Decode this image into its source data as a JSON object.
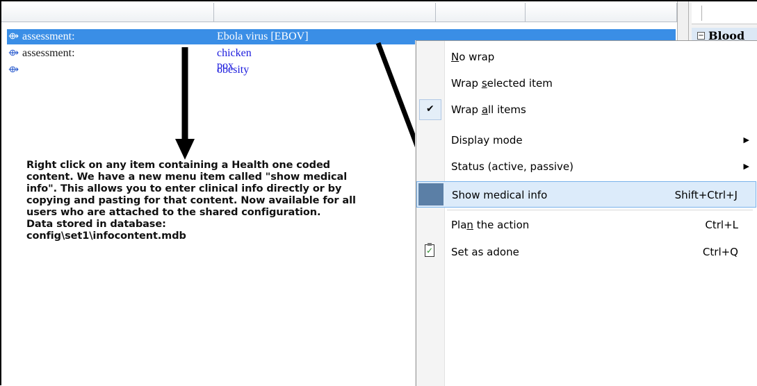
{
  "rows": [
    {
      "label": "assessment:",
      "value": "Ebola virus [EBOV]",
      "selected": true
    },
    {
      "label": "assessment:",
      "value": "chicken pox",
      "selected": false
    },
    {
      "label": "",
      "value": "obesity",
      "selected": false
    }
  ],
  "row_bullet": "⟴",
  "right_panel": {
    "tree_toggle": "−",
    "label": "Blood"
  },
  "annotation": "Right click on any item containing a Health one coded\ncontent. We have a new menu item called \"show medical\ninfo\". This allows you to enter clinical info directly or by\ncopying and pasting for that content. Now available for all\nusers who are attached to the shared configuration.\nData stored in database:\nconfig\\set1\\infocontent.mdb",
  "menu": {
    "no_wrap": {
      "pre": "",
      "u": "N",
      "post": "o wrap"
    },
    "wrap_selected": {
      "pre": "Wrap ",
      "u": "s",
      "post": "elected item"
    },
    "wrap_all": {
      "pre": "Wrap ",
      "u": "a",
      "post": "ll items",
      "check": "✔"
    },
    "display_mode": {
      "label": "Display mode",
      "arrow": "▶"
    },
    "status": {
      "label": "Status (active, passive)",
      "arrow": "▶"
    },
    "show_medical": {
      "label": "Show medical info",
      "shortcut": "Shift+Ctrl+J"
    },
    "plan": {
      "pre": "Pla",
      "u": "n",
      "post": " the action",
      "shortcut": "Ctrl+L"
    },
    "adone": {
      "label": "Set as adone",
      "shortcut": "Ctrl+Q"
    }
  },
  "colors": {
    "selection": "#3a8ee6",
    "link_text": "#1a1add",
    "menu_hover": "#dcebfa"
  }
}
